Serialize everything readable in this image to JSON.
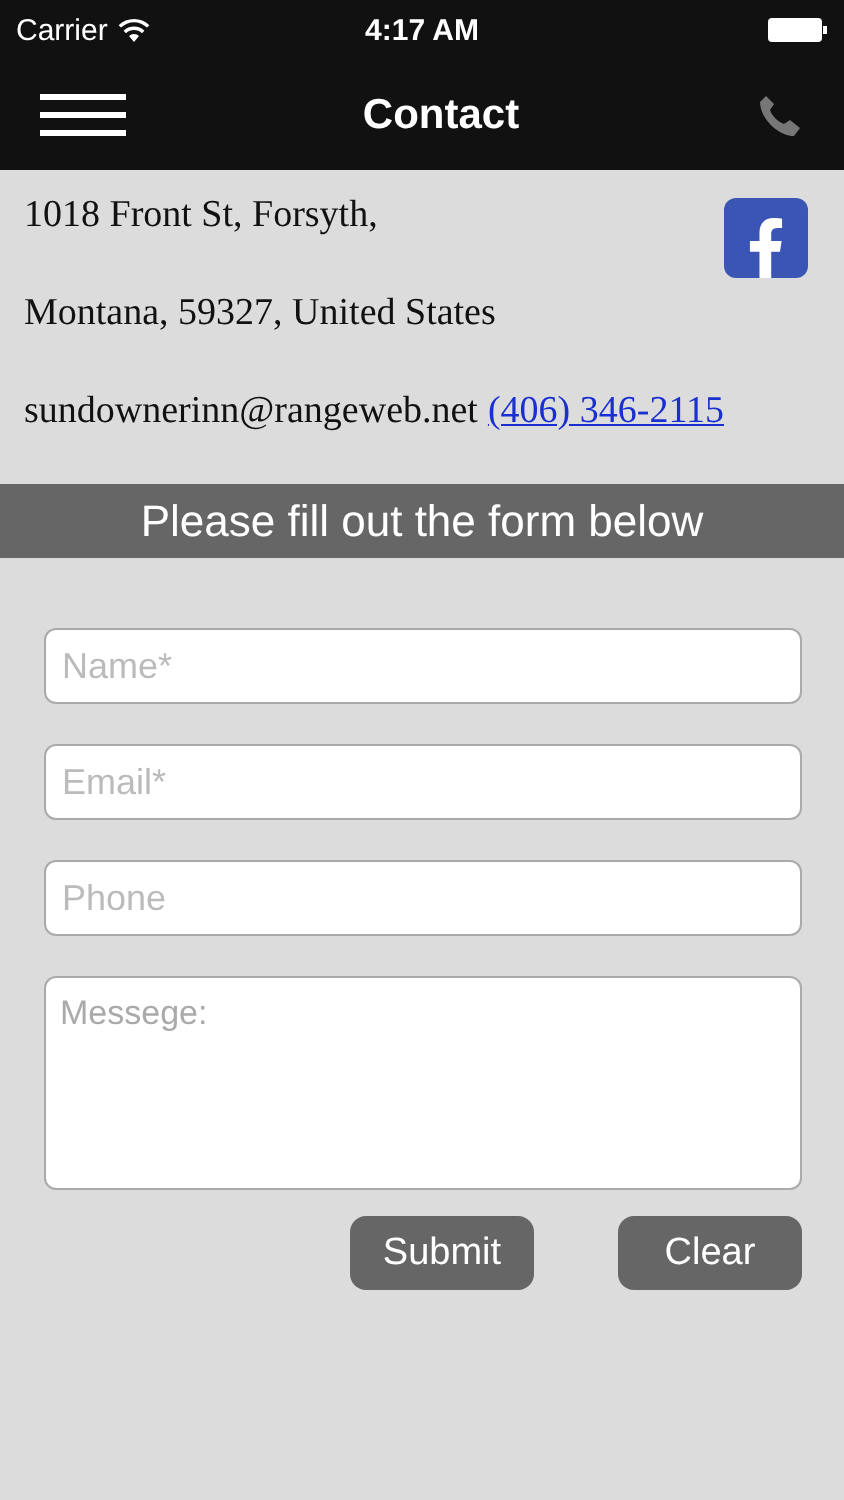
{
  "status_bar": {
    "carrier": "Carrier",
    "time": "4:17 AM"
  },
  "nav": {
    "title": "Contact"
  },
  "contact": {
    "address_lines": [
      "1018 Front St, Forsyth,",
      "Montana, 59327, United States"
    ],
    "email": "sundownerinn@rangeweb.net",
    "phone": "(406) 346-2115"
  },
  "banner": "Please fill out the form below",
  "form": {
    "fields": [
      {
        "kind": "input",
        "placeholder": "Name*"
      },
      {
        "kind": "input",
        "placeholder": "Email*"
      },
      {
        "kind": "input",
        "placeholder": "Phone"
      },
      {
        "kind": "textarea",
        "placeholder": "Messege:"
      }
    ],
    "buttons": [
      "Submit",
      "Clear"
    ]
  }
}
